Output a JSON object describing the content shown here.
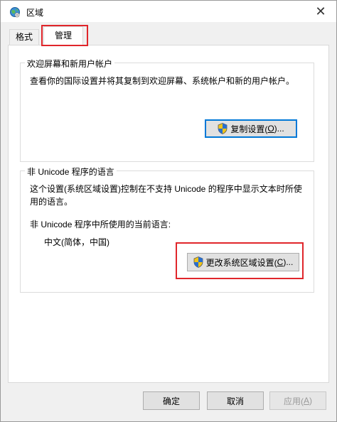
{
  "window": {
    "title": "区域"
  },
  "tabs": [
    {
      "label": "格式"
    },
    {
      "label": "管理"
    }
  ],
  "welcome_group": {
    "title": "欢迎屏幕和新用户帐户",
    "description": "查看你的国际设置并将其复制到欢迎屏幕、系统帐户和新的用户帐户。",
    "copy_button_label": "复制设置(",
    "copy_button_key": "O",
    "copy_button_suffix": ")..."
  },
  "unicode_group": {
    "title": "非 Unicode 程序的语言",
    "description_line1": "这个设置(系统区域设置)控制在不支持 Unicode 的程序中显示文本时所使",
    "description_line2": "用的语言。",
    "current_label": "非 Unicode 程序中所使用的当前语言:",
    "current_value": "中文(简体，中国)",
    "change_button_label": "更改系统区域设置(",
    "change_button_key": "C",
    "change_button_suffix": ")..."
  },
  "footer": {
    "ok_label": "确定",
    "cancel_label": "取消",
    "apply_label": "应用(",
    "apply_key": "A",
    "apply_suffix": ")"
  },
  "colors": {
    "highlight": "#e0262b",
    "default_button_border": "#0078d7"
  }
}
